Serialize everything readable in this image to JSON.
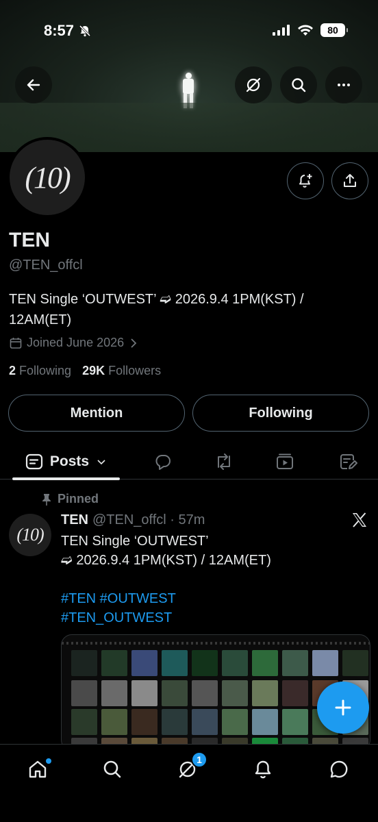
{
  "status_bar": {
    "time": "8:57",
    "battery": "80"
  },
  "profile": {
    "name": "TEN",
    "handle": "@TEN_offcl",
    "avatar_text": "(10)",
    "bio_line1": "TEN Single ‘OUTWEST’ ➫ 2026.9.4 1PM(KST) /",
    "bio_line2": "12AM(ET)",
    "joined": "Joined June 2026",
    "following_count": "2",
    "following_label": "Following",
    "followers_count": "29K",
    "followers_label": "Followers"
  },
  "buttons": {
    "mention": "Mention",
    "following": "Following"
  },
  "tabs": {
    "posts_label": "Posts"
  },
  "pinned_post": {
    "pinned_label": "Pinned",
    "author": "TEN",
    "handle_time": "@TEN_offcl · 57m",
    "line1": "TEN Single ‘OUTWEST’",
    "line2": "➫ 2026.9.4 1PM(KST) / 12AM(ET)",
    "tag_line1": "#TEN #OUTWEST",
    "tag_line2": "#TEN_OUTWEST"
  },
  "bottom_nav": {
    "grok_badge": "1"
  },
  "colors": {
    "accent": "#1d9bf0",
    "muted": "#71767b",
    "border": "#2f3336",
    "text": "#e7e9ea"
  }
}
